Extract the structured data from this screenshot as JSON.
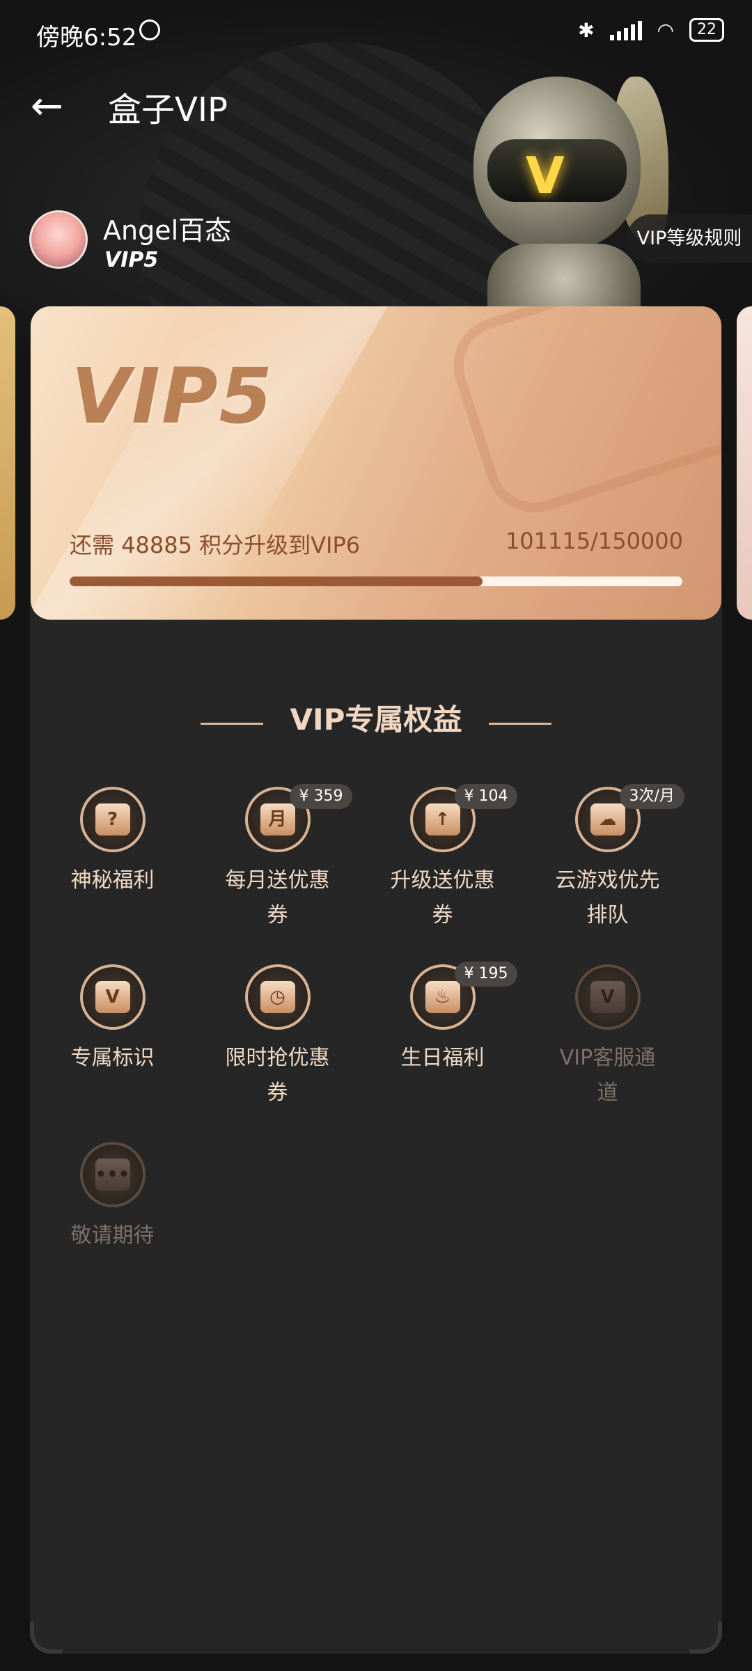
{
  "status": {
    "time": "傍晚6:52",
    "battery": "22"
  },
  "header": {
    "title": "盒子VIP"
  },
  "user": {
    "name": "Angel百态",
    "level": "VIP5"
  },
  "rules_button": "VIP等级规则",
  "card": {
    "level": "VIP5",
    "upgrade_text": "还需 48885 积分升级到VIP6",
    "points_text": "101115/150000",
    "progress_fraction": 0.674
  },
  "benefits": {
    "title": "VIP专属权益",
    "items": [
      {
        "label": "神秘福利",
        "icon": "mystery-gift-icon",
        "glyph": "?",
        "badge": "",
        "dim": false
      },
      {
        "label": "每月送优惠券",
        "icon": "monthly-coupon-icon",
        "glyph": "月",
        "badge": "¥ 359",
        "dim": false
      },
      {
        "label": "升级送优惠券",
        "icon": "upgrade-coupon-icon",
        "glyph": "↑",
        "badge": "¥ 104",
        "dim": false
      },
      {
        "label": "云游戏优先排队",
        "icon": "cloud-game-icon",
        "glyph": "☁",
        "badge": "3次/月",
        "dim": false
      },
      {
        "label": "专属标识",
        "icon": "exclusive-badge-icon",
        "glyph": "V",
        "badge": "",
        "dim": false
      },
      {
        "label": "限时抢优惠券",
        "icon": "flash-coupon-icon",
        "glyph": "◷",
        "badge": "",
        "dim": false
      },
      {
        "label": "生日福利",
        "icon": "birthday-cake-icon",
        "glyph": "♨",
        "badge": "¥ 195",
        "dim": false
      },
      {
        "label": "VIP客服通道",
        "icon": "vip-service-icon",
        "glyph": "V",
        "badge": "",
        "dim": true
      },
      {
        "label": "敬请期待",
        "icon": "coming-soon-icon",
        "glyph": "•••",
        "badge": "",
        "dim": true
      }
    ]
  }
}
